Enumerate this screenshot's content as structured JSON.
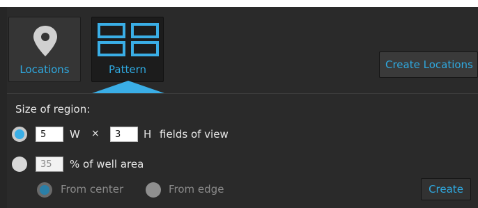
{
  "toolbar": {
    "locations_label": "Locations",
    "pattern_label": "Pattern",
    "create_locations_label": "Create Locations"
  },
  "region": {
    "heading": "Size of region:",
    "fov": {
      "width_value": "5",
      "width_unit": "W",
      "times": "×",
      "height_value": "3",
      "height_unit": "H",
      "suffix": "fields of view",
      "selected": true
    },
    "percent": {
      "value": "35",
      "suffix": "% of well area",
      "selected": false,
      "from_center_label": "From center",
      "from_edge_label": "From edge"
    }
  },
  "actions": {
    "create_label": "Create"
  },
  "colors": {
    "accent": "#2fa9e0",
    "panel": "#2a2a2a"
  },
  "icons": {
    "locations": "map-pin-icon",
    "pattern": "grid-pattern-icon"
  }
}
